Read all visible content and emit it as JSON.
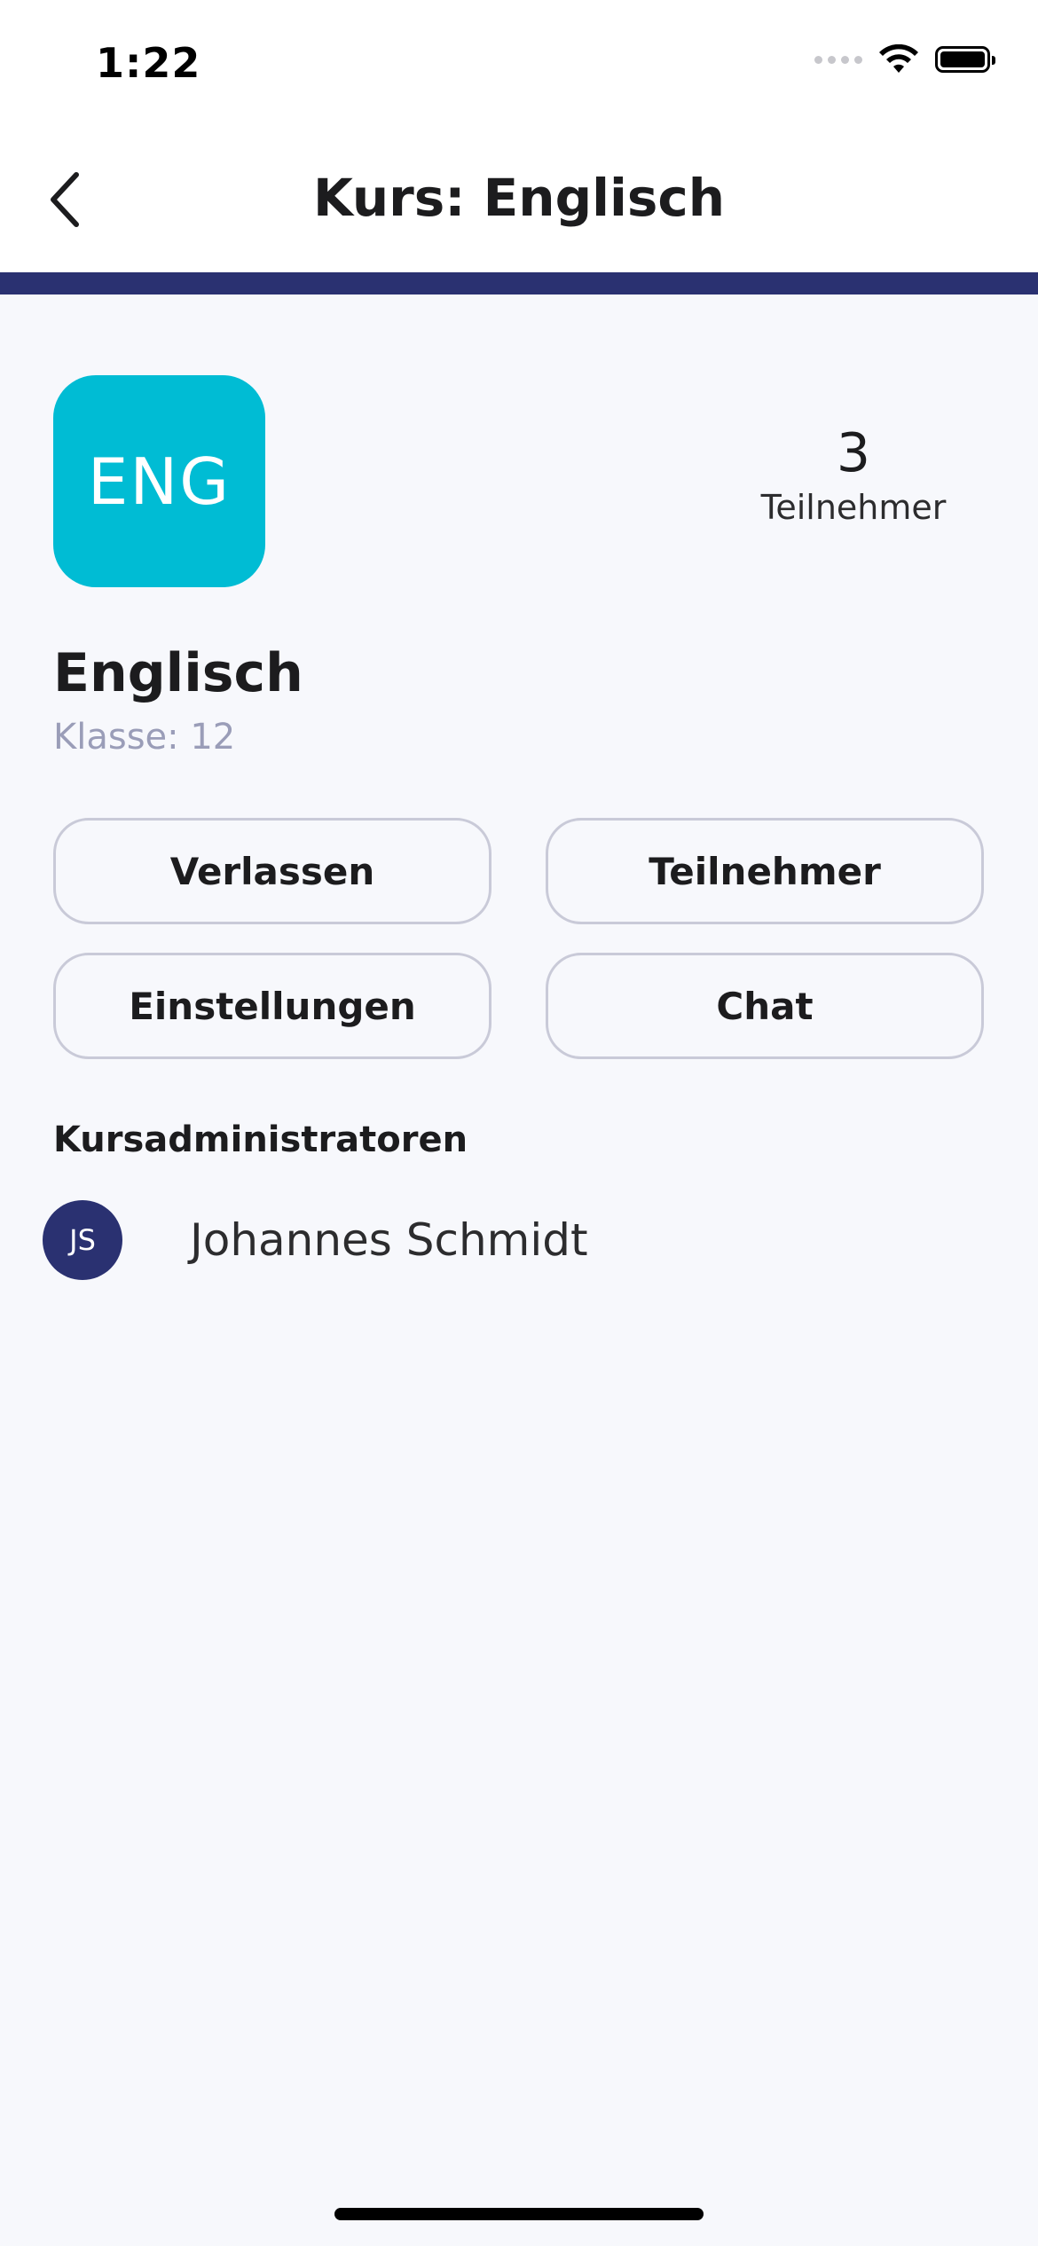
{
  "status_bar": {
    "time": "1:22",
    "icons": [
      "signal-icon",
      "wifi-icon",
      "battery-icon"
    ]
  },
  "nav": {
    "title": "Kurs: Englisch",
    "back_icon": "chevron-left-icon"
  },
  "course": {
    "logo_text": "ENG",
    "logo_color": "#00bcd4",
    "name": "Englisch",
    "class_label": "Klasse: 12",
    "participants_count": "3",
    "participants_label": "Teilnehmer"
  },
  "actions": {
    "leave": "Verlassen",
    "participants": "Teilnehmer",
    "settings": "Einstellungen",
    "chat": "Chat"
  },
  "admins": {
    "heading": "Kursadministratoren",
    "items": [
      {
        "initials": "JS",
        "name": "Johannes Schmidt"
      }
    ]
  },
  "colors": {
    "accent": "#2a3171",
    "background": "#f7f8fc"
  }
}
